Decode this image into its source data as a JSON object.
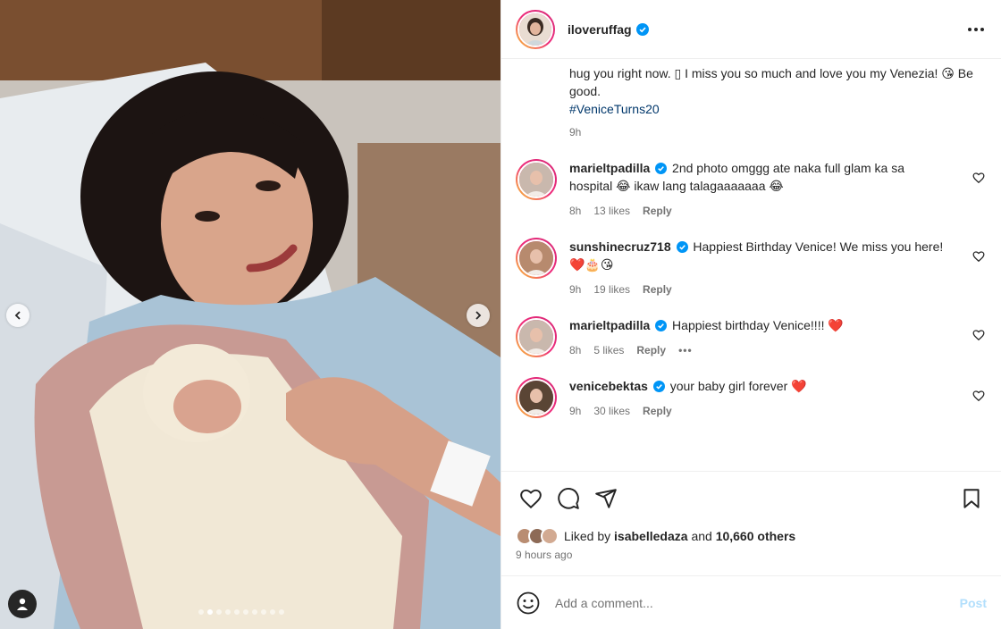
{
  "photo": {
    "carousel_dots": 10,
    "active_dot": 1
  },
  "header": {
    "username": "iloveruffag",
    "more_icon": "more-horizontal-icon"
  },
  "caption": {
    "text": "hug you right now. ▯ I miss you so much and love you my Venezia! 😘 Be good.",
    "hashtag": "#VeniceTurns20",
    "time": "9h"
  },
  "comments": [
    {
      "username": "marieltpadilla",
      "verified": true,
      "text": "2nd photo omggg ate naka full glam ka sa hospital 😂 ikaw lang talagaaaaaaa 😂",
      "time": "8h",
      "likes": "13 likes",
      "reply": "Reply",
      "avatar_color": "#c9b8ad"
    },
    {
      "username": "sunshinecruz718",
      "verified": true,
      "text": "Happiest Birthday Venice! We miss you here! ❤️🎂😘",
      "time": "9h",
      "likes": "19 likes",
      "reply": "Reply",
      "avatar_color": "#b78a6e"
    },
    {
      "username": "marieltpadilla",
      "verified": true,
      "text": "Happiest birthday Venice!!!! ❤️",
      "time": "8h",
      "likes": "5 likes",
      "reply": "Reply",
      "more": "•••",
      "avatar_color": "#c9b8ad"
    },
    {
      "username": "venicebektas",
      "verified": true,
      "text": "your baby girl forever ❤️",
      "time": "9h",
      "likes": "30 likes",
      "reply": "Reply",
      "avatar_color": "#5a4535"
    }
  ],
  "actions": {
    "liked_by_prefix": "Liked by",
    "liked_by_user": "isabelledaza",
    "liked_by_and": "and",
    "liked_by_others": "10,660 others",
    "time_ago": "9 hours ago"
  },
  "add_comment": {
    "placeholder": "Add a comment...",
    "post_label": "Post"
  },
  "colors": {
    "link": "#00376b",
    "verified": "#0095f6",
    "muted": "#737373",
    "post_disabled": "#b2dffc"
  }
}
